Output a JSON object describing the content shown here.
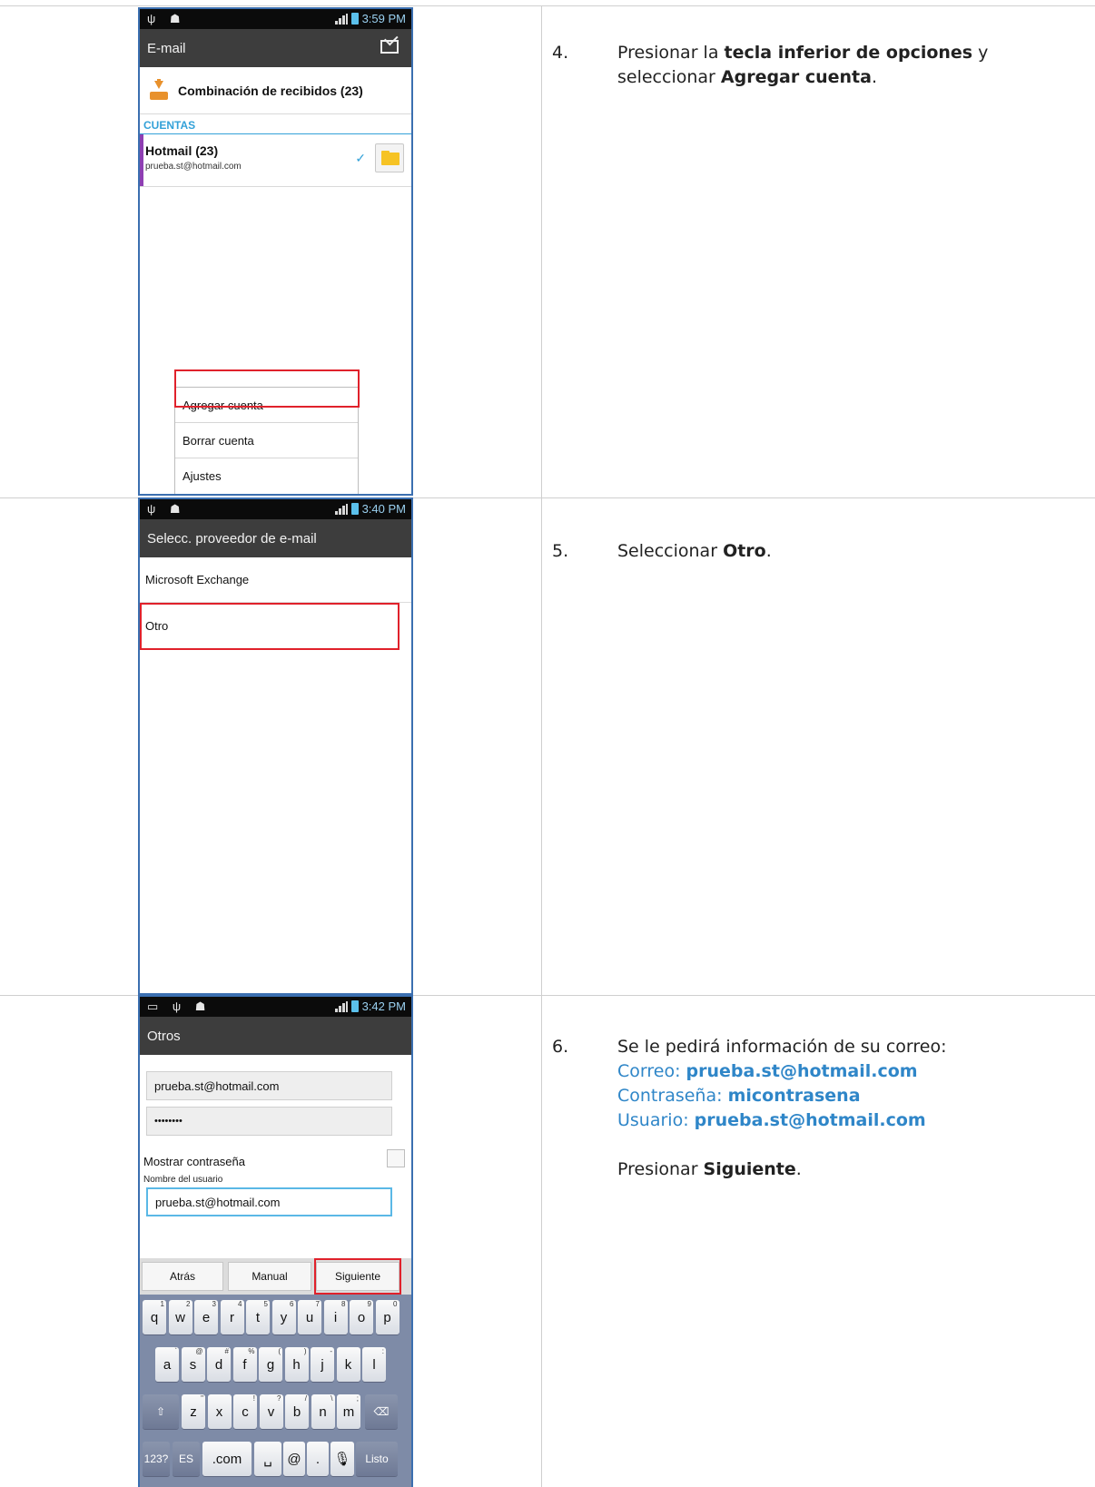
{
  "phone1": {
    "status_time": "3:59 PM",
    "status_icons_left": "usb-icon android-icon",
    "action_title": "E-mail",
    "compose_icon": "envelope-icon",
    "combined_label": "Combinación de recibidos (23)",
    "section_label": "CUENTAS",
    "account": {
      "name": "Hotmail (23)",
      "email": "prueba.st@hotmail.com",
      "check": "✓"
    },
    "menu": [
      "Agregar cuenta",
      "Borrar cuenta",
      "Ajustes"
    ]
  },
  "phone2": {
    "status_time": "3:40 PM",
    "action_title": "Selecc. proveedor de e-mail",
    "providers": [
      "Microsoft Exchange",
      "Otro"
    ]
  },
  "phone3": {
    "status_time": "3:42 PM",
    "action_title": "Otros",
    "email_value": "prueba.st@hotmail.com",
    "password_value": "••••••••",
    "show_password_label": "Mostrar contraseña",
    "username_label": "Nombre del usuario",
    "username_value": "prueba.st@hotmail.com",
    "buttons": {
      "back": "Atrás",
      "manual": "Manual",
      "next": "Siguiente"
    },
    "keyboard": {
      "row1": [
        "q",
        "w",
        "e",
        "r",
        "t",
        "y",
        "u",
        "i",
        "o",
        "p"
      ],
      "row1_sub": [
        "1",
        "2",
        "3",
        "4",
        "5",
        "6",
        "7",
        "8",
        "9",
        "0"
      ],
      "row2": [
        "a",
        "s",
        "d",
        "f",
        "g",
        "h",
        "j",
        "k",
        "l"
      ],
      "row2_sub": [
        "`",
        "@",
        "#",
        "%",
        "(",
        ")",
        "-",
        "",
        ":"
      ],
      "row3": [
        "z",
        "x",
        "c",
        "v",
        "b",
        "n",
        "m"
      ],
      "row3_sub": [
        "\"",
        "",
        "!",
        "?",
        "/",
        "\\",
        ";"
      ],
      "shift": "⇧",
      "backspace": "⌫",
      "sym": "123?",
      "lang": "ES",
      "dotcom": ".com",
      "space": "␣",
      "at": "@",
      "period": ".",
      "mic": "🎙",
      "done": "Listo"
    }
  },
  "steps": {
    "s4": {
      "num": "4.",
      "t1": "Presionar la ",
      "b1": "tecla inferior de opciones",
      "t2": " y seleccionar ",
      "b2": "Agregar cuenta",
      "t3": "."
    },
    "s5": {
      "num": "5.",
      "t1": "Seleccionar ",
      "b1": "Otro",
      "t2": "."
    },
    "s6": {
      "num": "6.",
      "intro": "Se le pedirá información de su correo:",
      "l1_label": "Correo: ",
      "l1_value": "prueba.st@hotmail.com",
      "l2_label": "Contraseña: ",
      "l2_value": "micontrasena",
      "l3_label": "Usuario: ",
      "l3_value": "prueba.st@hotmail.com",
      "p_t1": "Presionar ",
      "p_b1": "Siguiente",
      "p_t2": "."
    }
  },
  "colors": {
    "accent_blue": "#33a1d8",
    "highlight_red": "#e0212b",
    "text_blue": "#2f86c8"
  }
}
